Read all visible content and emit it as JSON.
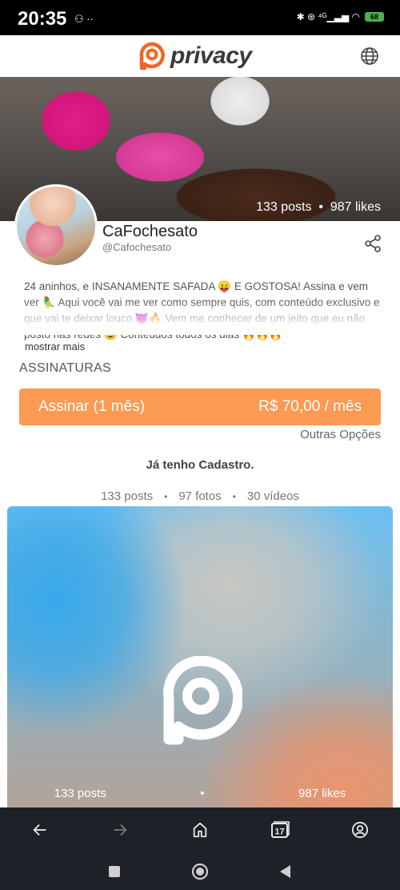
{
  "status_bar": {
    "time": "20:35",
    "left_icons": "⚇ ··",
    "right_icons": "✱ ⊛ ⁴ᴳ▁▃▅ ◠",
    "battery": "68"
  },
  "header": {
    "logo_text": "privacy",
    "brand_color": "#f26522"
  },
  "cover": {
    "posts": "133 posts",
    "likes": "987 likes",
    "separator": "•"
  },
  "profile": {
    "name": "CaFochesato",
    "handle": "@Cafochesato",
    "bio": "24 aninhos, e INSANAMENTE SAFADA 😛 E GOSTOSA! Assina e vem ver 🦜 Aqui você vai me ver como sempre quis, com conteúdo exclusivo e que vai te deixar louco 😈🔥 Vem me conhecer de um jeito que eu não posto nas redes 😉 Conteúdos todos os dias 🔥🔥🔥",
    "show_more": "mostrar mais"
  },
  "subscriptions": {
    "title": "ASSINATURAS",
    "plan_label": "Assinar (1 mês)",
    "plan_price": "R$ 70,00 / mês",
    "other_options": "Outras Opções",
    "login": "Já tenho Cadastro.",
    "button_color": "#fb9a52"
  },
  "counts": {
    "posts": "133 posts",
    "photos": "97 fotos",
    "videos": "30 vídeos",
    "separator": "•"
  },
  "media_card": {
    "posts": "133 posts",
    "likes": "987 likes",
    "separator": "•"
  },
  "browser_nav": {
    "icons": [
      "back-arrow-icon",
      "forward-arrow-icon",
      "home-icon",
      "tabs-icon",
      "account-icon"
    ],
    "tabs_count": "17"
  },
  "system_nav": {
    "icons": [
      "recents-square-icon",
      "home-circle-icon",
      "back-triangle-icon"
    ]
  }
}
